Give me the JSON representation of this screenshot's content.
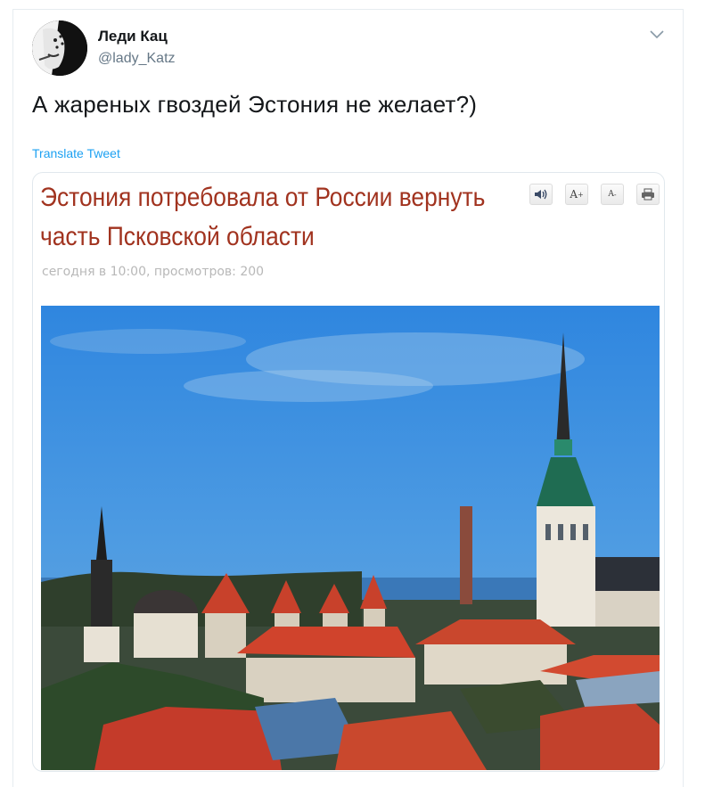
{
  "author": {
    "name": "Леди Кац",
    "handle": "@lady_Katz"
  },
  "tweet": {
    "text": "А жареных гвоздей Эстония не желает?)",
    "translate_label": "Translate Tweet"
  },
  "card": {
    "headline_line1": "Эстония потребовала от России вернуть",
    "headline_line2": "часть Псковской области",
    "meta": "сегодня в 10:00, просмотров: 200",
    "toolbar": {
      "sound_icon": "speaker-icon",
      "font_increase_label": "A",
      "font_decrease_label": "A",
      "print_icon": "printer-icon"
    },
    "photo_description_icon": "tallinn-skyline-image"
  },
  "colors": {
    "headline": "#a1331f",
    "link": "#1da1f2",
    "handle": "#657786",
    "sky": "#3f8edc"
  }
}
